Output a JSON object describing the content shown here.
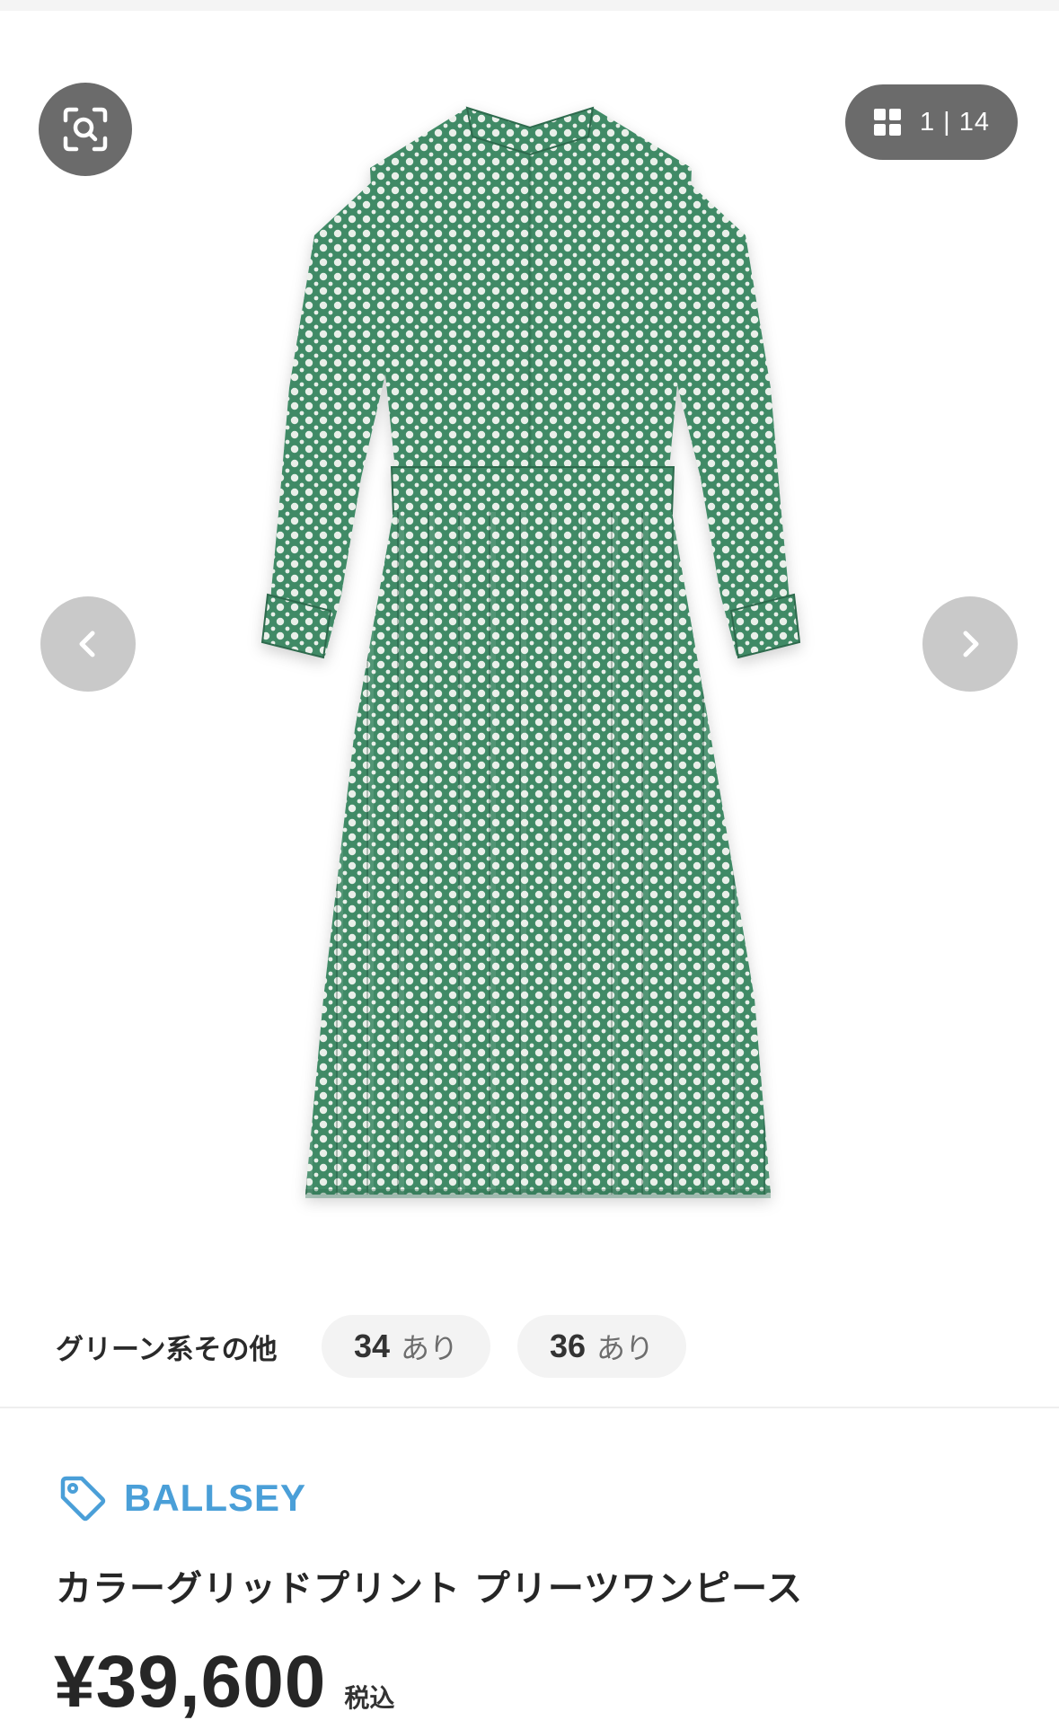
{
  "gallery": {
    "counter_text": "1 | 14",
    "current_index": 1,
    "total_images": 14,
    "dress_colors": {
      "base": "#3f8a66",
      "dot": "#e9efe9",
      "shadow": "#2f6b4e"
    }
  },
  "variants": {
    "color_label": "グリーン系その他",
    "sizes": [
      {
        "size": "34",
        "stock": "あり"
      },
      {
        "size": "36",
        "stock": "あり"
      }
    ]
  },
  "product": {
    "brand": "BALLSEY",
    "brand_color": "#4a9fd8",
    "name": "カラーグリッドプリント プリーツワンピース",
    "price": "¥39,600",
    "tax_label": "税込"
  }
}
